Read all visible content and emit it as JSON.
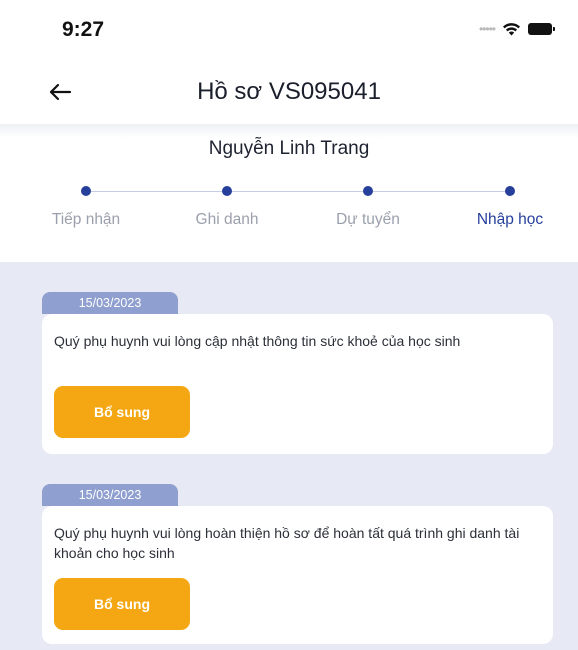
{
  "status_bar": {
    "time": "9:27",
    "icons": [
      "signal-dots-icon",
      "wifi-icon",
      "battery-icon"
    ]
  },
  "header": {
    "back_icon": "arrow-left-icon",
    "title": "Hồ sơ VS095041"
  },
  "applicant": {
    "name": "Nguyễn Linh Trang"
  },
  "stepper": {
    "steps": [
      {
        "label": "Tiếp nhận",
        "active": false
      },
      {
        "label": "Ghi danh",
        "active": false
      },
      {
        "label": "Dự tuyển",
        "active": false
      },
      {
        "label": "Nhập học",
        "active": true
      }
    ]
  },
  "notifications": [
    {
      "date": "15/03/2023",
      "message": "Quý phụ huynh vui lòng cập nhật thông tin sức khoẻ của học sinh",
      "button_label": "Bổ sung"
    },
    {
      "date": "15/03/2023",
      "message": "Quý phụ huynh vui lòng hoàn thiện hồ sơ để hoàn tất quá trình ghi danh tài khoản cho học sinh",
      "button_label": "Bổ sung"
    }
  ],
  "colors": {
    "primary": "#253f9b",
    "accent": "#f5a713",
    "date_tab": "#8f9fcf",
    "content_background": "#e7e9f5"
  }
}
